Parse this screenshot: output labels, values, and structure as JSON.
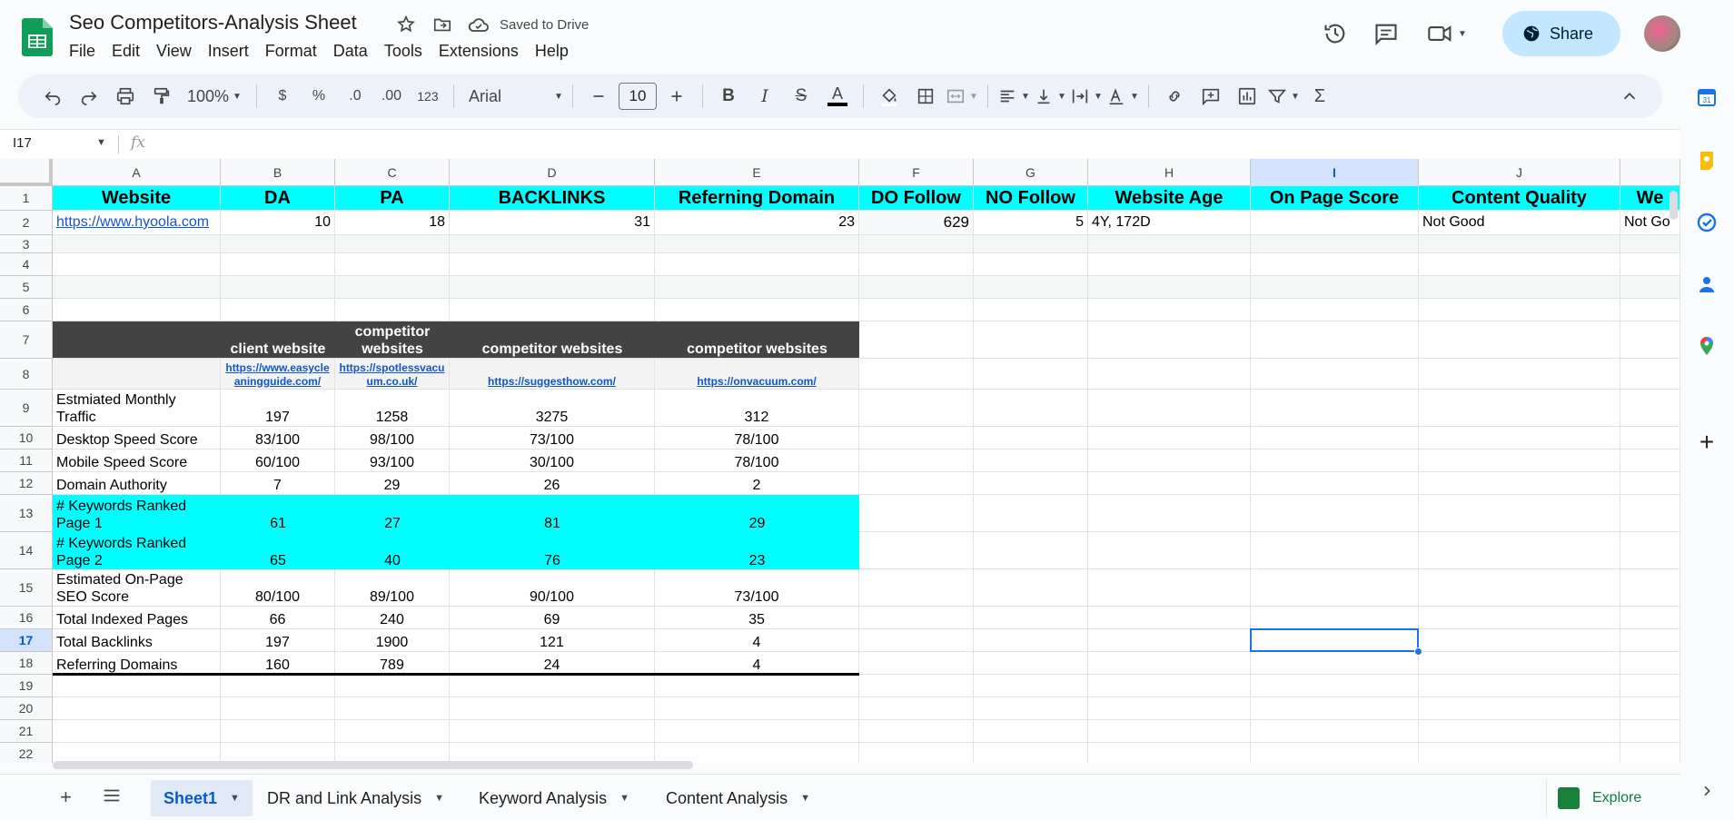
{
  "header": {
    "title": "Seo Competitors-Analysis Sheet",
    "saved_status": "Saved to Drive",
    "share_label": "Share",
    "menu": [
      "File",
      "Edit",
      "View",
      "Insert",
      "Format",
      "Data",
      "Tools",
      "Extensions",
      "Help"
    ]
  },
  "toolbar": {
    "zoom": "100%",
    "currency": "$",
    "percent": "%",
    "dec_decrease": ".0",
    "dec_increase": ".00",
    "number_format": "123",
    "font": "Arial",
    "font_size": "10"
  },
  "formula_bar": {
    "name_box": "I17",
    "fx_label": "fx"
  },
  "columns": [
    "A",
    "B",
    "C",
    "D",
    "E",
    "F",
    "G",
    "H",
    "I",
    "J"
  ],
  "rows": [
    "1",
    "2",
    "3",
    "4",
    "5",
    "6",
    "7",
    "8",
    "9",
    "10",
    "11",
    "12",
    "13",
    "14",
    "15",
    "16",
    "17",
    "18",
    "19",
    "20",
    "21",
    "22"
  ],
  "row1": [
    "Website",
    "DA",
    "PA",
    "BACKLINKS",
    "Referning Domain",
    "DO Follow",
    "NO Follow",
    "Website Age",
    "On Page Score",
    "Content Quality",
    "We"
  ],
  "row2": [
    "https://www.hyoola.com",
    "10",
    "18",
    "31",
    "23",
    "629",
    "5",
    "4Y, 172D",
    "",
    "Not Good",
    "Not Go"
  ],
  "comp_header": [
    "",
    "client website",
    "competitor websites",
    "competitor websites",
    "competitor websites"
  ],
  "comp_links": [
    "",
    "https://www.easycleaningguide.com/",
    "https://spotlessvacuum.co.uk/",
    "https://suggesthow.com/",
    "https://onvacuum.com/"
  ],
  "comp_rows": [
    [
      "Estmiated Monthly Traffic",
      "197",
      "1258",
      "3275",
      "312"
    ],
    [
      "Desktop Speed Score",
      "83/100",
      "98/100",
      "73/100",
      "78/100"
    ],
    [
      "Mobile Speed Score",
      "60/100",
      "93/100",
      "30/100",
      "78/100"
    ],
    [
      "Domain Authority",
      "7",
      "29",
      "26",
      "2"
    ],
    [
      "# Keywords Ranked Page 1",
      "61",
      "27",
      "81",
      "29"
    ],
    [
      "# Keywords Ranked Page 2",
      "65",
      "40",
      "76",
      "23"
    ],
    [
      "Estimated On-Page SEO Score",
      "80/100",
      "89/100",
      "90/100",
      "73/100"
    ],
    [
      "Total Indexed Pages",
      "66",
      "240",
      "69",
      "35"
    ],
    [
      "Total Backlinks",
      "197",
      "1900",
      "121",
      "4"
    ],
    [
      "Referring Domains",
      "160",
      "789",
      "24",
      "4"
    ]
  ],
  "sheet_tabs": [
    "Sheet1",
    "DR and Link Analysis",
    "Keyword Analysis",
    "Content Analysis"
  ],
  "explore_label": "Explore",
  "colors": {
    "cyan": "#00ffff",
    "dark_header": "#434343",
    "selection": "#1a73e8",
    "share_bg": "#c2e7ff"
  }
}
